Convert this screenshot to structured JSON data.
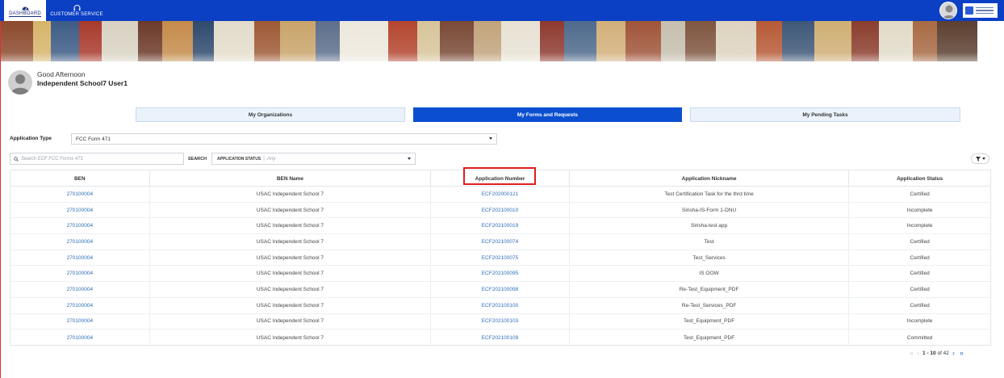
{
  "topnav": {
    "dashboard_label": "DASHBOARD",
    "customer_service_label": "CUSTOMER SERVICE"
  },
  "greeting": {
    "salutation": "Good Afternoon",
    "user_name": "Independent School7 User1"
  },
  "tabs": [
    {
      "label": "My Organizations",
      "active": false
    },
    {
      "label": "My Forms and Requests",
      "active": true
    },
    {
      "label": "My Pending Tasks",
      "active": false
    }
  ],
  "filters": {
    "application_type_label": "Application Type",
    "application_type_value": "FCC Form 471",
    "search_placeholder": "Search ECF FCC Forms 471",
    "search_button": "SEARCH",
    "status_label": "APPLICATION STATUS",
    "status_value": "Any"
  },
  "table": {
    "columns": [
      "BEN",
      "BEN Name",
      "Application Number",
      "Application Nickname",
      "Application Status"
    ],
    "rows": [
      {
        "ben": "270100004",
        "ben_name": "USAC Independent School 7",
        "app_number": "ECF202000121",
        "nickname": "Test Certification Task for the thrd time",
        "status": "Certified"
      },
      {
        "ben": "270100004",
        "ben_name": "USAC Independent School 7",
        "app_number": "ECF202100010",
        "nickname": "Sirisha-IS-Form 1-DNU",
        "status": "Incomplete"
      },
      {
        "ben": "270100004",
        "ben_name": "USAC Independent School 7",
        "app_number": "ECF202100019",
        "nickname": "Sirisha-test app",
        "status": "Incomplete"
      },
      {
        "ben": "270100004",
        "ben_name": "USAC Independent School 7",
        "app_number": "ECF202100074",
        "nickname": "Test",
        "status": "Certified"
      },
      {
        "ben": "270100004",
        "ben_name": "USAC Independent School 7",
        "app_number": "ECF202100075",
        "nickname": "Test_Services",
        "status": "Certified"
      },
      {
        "ben": "270100004",
        "ben_name": "USAC Independent School 7",
        "app_number": "ECF202100095",
        "nickname": "IS OOW",
        "status": "Certified"
      },
      {
        "ben": "270100004",
        "ben_name": "USAC Independent School 7",
        "app_number": "ECF202100098",
        "nickname": "Re-Test_Equipment_PDF",
        "status": "Certified"
      },
      {
        "ben": "270100004",
        "ben_name": "USAC Independent School 7",
        "app_number": "ECF202100100",
        "nickname": "Re-Test_Services_PDF",
        "status": "Certified"
      },
      {
        "ben": "270100004",
        "ben_name": "USAC Independent School 7",
        "app_number": "ECF202100103",
        "nickname": "Test_Equipment_PDF",
        "status": "Incomplete"
      },
      {
        "ben": "270100004",
        "ben_name": "USAC Independent School 7",
        "app_number": "ECF202100109",
        "nickname": "Test_Equipment_PDF",
        "status": "Committed"
      }
    ]
  },
  "pagination": {
    "range": "1 - 10",
    "of_text": "of 42"
  },
  "colors": {
    "nav_blue": "#0b3fc4",
    "active_tab": "#0b4fd0",
    "link": "#2e6fb8",
    "highlight": "#e01e1e"
  }
}
